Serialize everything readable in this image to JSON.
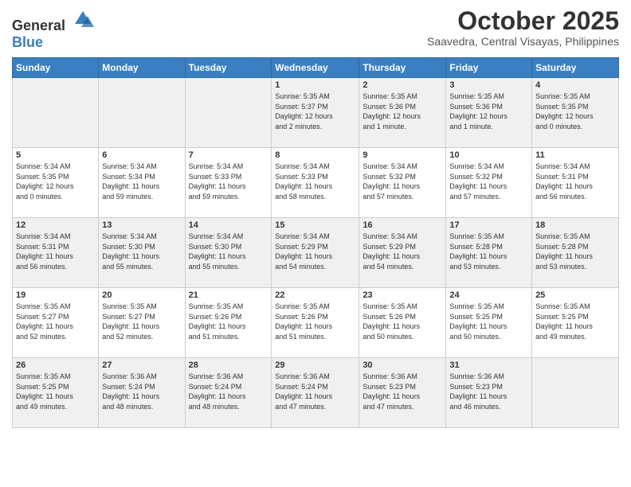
{
  "header": {
    "logo": {
      "general": "General",
      "blue": "Blue"
    },
    "title": "October 2025",
    "subtitle": "Saavedra, Central Visayas, Philippines"
  },
  "weekdays": [
    "Sunday",
    "Monday",
    "Tuesday",
    "Wednesday",
    "Thursday",
    "Friday",
    "Saturday"
  ],
  "weeks": [
    [
      {
        "day": "",
        "info": ""
      },
      {
        "day": "",
        "info": ""
      },
      {
        "day": "",
        "info": ""
      },
      {
        "day": "1",
        "info": "Sunrise: 5:35 AM\nSunset: 5:37 PM\nDaylight: 12 hours\nand 2 minutes."
      },
      {
        "day": "2",
        "info": "Sunrise: 5:35 AM\nSunset: 5:36 PM\nDaylight: 12 hours\nand 1 minute."
      },
      {
        "day": "3",
        "info": "Sunrise: 5:35 AM\nSunset: 5:36 PM\nDaylight: 12 hours\nand 1 minute."
      },
      {
        "day": "4",
        "info": "Sunrise: 5:35 AM\nSunset: 5:35 PM\nDaylight: 12 hours\nand 0 minutes."
      }
    ],
    [
      {
        "day": "5",
        "info": "Sunrise: 5:34 AM\nSunset: 5:35 PM\nDaylight: 12 hours\nand 0 minutes."
      },
      {
        "day": "6",
        "info": "Sunrise: 5:34 AM\nSunset: 5:34 PM\nDaylight: 11 hours\nand 59 minutes."
      },
      {
        "day": "7",
        "info": "Sunrise: 5:34 AM\nSunset: 5:33 PM\nDaylight: 11 hours\nand 59 minutes."
      },
      {
        "day": "8",
        "info": "Sunrise: 5:34 AM\nSunset: 5:33 PM\nDaylight: 11 hours\nand 58 minutes."
      },
      {
        "day": "9",
        "info": "Sunrise: 5:34 AM\nSunset: 5:32 PM\nDaylight: 11 hours\nand 57 minutes."
      },
      {
        "day": "10",
        "info": "Sunrise: 5:34 AM\nSunset: 5:32 PM\nDaylight: 11 hours\nand 57 minutes."
      },
      {
        "day": "11",
        "info": "Sunrise: 5:34 AM\nSunset: 5:31 PM\nDaylight: 11 hours\nand 56 minutes."
      }
    ],
    [
      {
        "day": "12",
        "info": "Sunrise: 5:34 AM\nSunset: 5:31 PM\nDaylight: 11 hours\nand 56 minutes."
      },
      {
        "day": "13",
        "info": "Sunrise: 5:34 AM\nSunset: 5:30 PM\nDaylight: 11 hours\nand 55 minutes."
      },
      {
        "day": "14",
        "info": "Sunrise: 5:34 AM\nSunset: 5:30 PM\nDaylight: 11 hours\nand 55 minutes."
      },
      {
        "day": "15",
        "info": "Sunrise: 5:34 AM\nSunset: 5:29 PM\nDaylight: 11 hours\nand 54 minutes."
      },
      {
        "day": "16",
        "info": "Sunrise: 5:34 AM\nSunset: 5:29 PM\nDaylight: 11 hours\nand 54 minutes."
      },
      {
        "day": "17",
        "info": "Sunrise: 5:35 AM\nSunset: 5:28 PM\nDaylight: 11 hours\nand 53 minutes."
      },
      {
        "day": "18",
        "info": "Sunrise: 5:35 AM\nSunset: 5:28 PM\nDaylight: 11 hours\nand 53 minutes."
      }
    ],
    [
      {
        "day": "19",
        "info": "Sunrise: 5:35 AM\nSunset: 5:27 PM\nDaylight: 11 hours\nand 52 minutes."
      },
      {
        "day": "20",
        "info": "Sunrise: 5:35 AM\nSunset: 5:27 PM\nDaylight: 11 hours\nand 52 minutes."
      },
      {
        "day": "21",
        "info": "Sunrise: 5:35 AM\nSunset: 5:26 PM\nDaylight: 11 hours\nand 51 minutes."
      },
      {
        "day": "22",
        "info": "Sunrise: 5:35 AM\nSunset: 5:26 PM\nDaylight: 11 hours\nand 51 minutes."
      },
      {
        "day": "23",
        "info": "Sunrise: 5:35 AM\nSunset: 5:26 PM\nDaylight: 11 hours\nand 50 minutes."
      },
      {
        "day": "24",
        "info": "Sunrise: 5:35 AM\nSunset: 5:25 PM\nDaylight: 11 hours\nand 50 minutes."
      },
      {
        "day": "25",
        "info": "Sunrise: 5:35 AM\nSunset: 5:25 PM\nDaylight: 11 hours\nand 49 minutes."
      }
    ],
    [
      {
        "day": "26",
        "info": "Sunrise: 5:35 AM\nSunset: 5:25 PM\nDaylight: 11 hours\nand 49 minutes."
      },
      {
        "day": "27",
        "info": "Sunrise: 5:36 AM\nSunset: 5:24 PM\nDaylight: 11 hours\nand 48 minutes."
      },
      {
        "day": "28",
        "info": "Sunrise: 5:36 AM\nSunset: 5:24 PM\nDaylight: 11 hours\nand 48 minutes."
      },
      {
        "day": "29",
        "info": "Sunrise: 5:36 AM\nSunset: 5:24 PM\nDaylight: 11 hours\nand 47 minutes."
      },
      {
        "day": "30",
        "info": "Sunrise: 5:36 AM\nSunset: 5:23 PM\nDaylight: 11 hours\nand 47 minutes."
      },
      {
        "day": "31",
        "info": "Sunrise: 5:36 AM\nSunset: 5:23 PM\nDaylight: 11 hours\nand 46 minutes."
      },
      {
        "day": "",
        "info": ""
      }
    ]
  ]
}
